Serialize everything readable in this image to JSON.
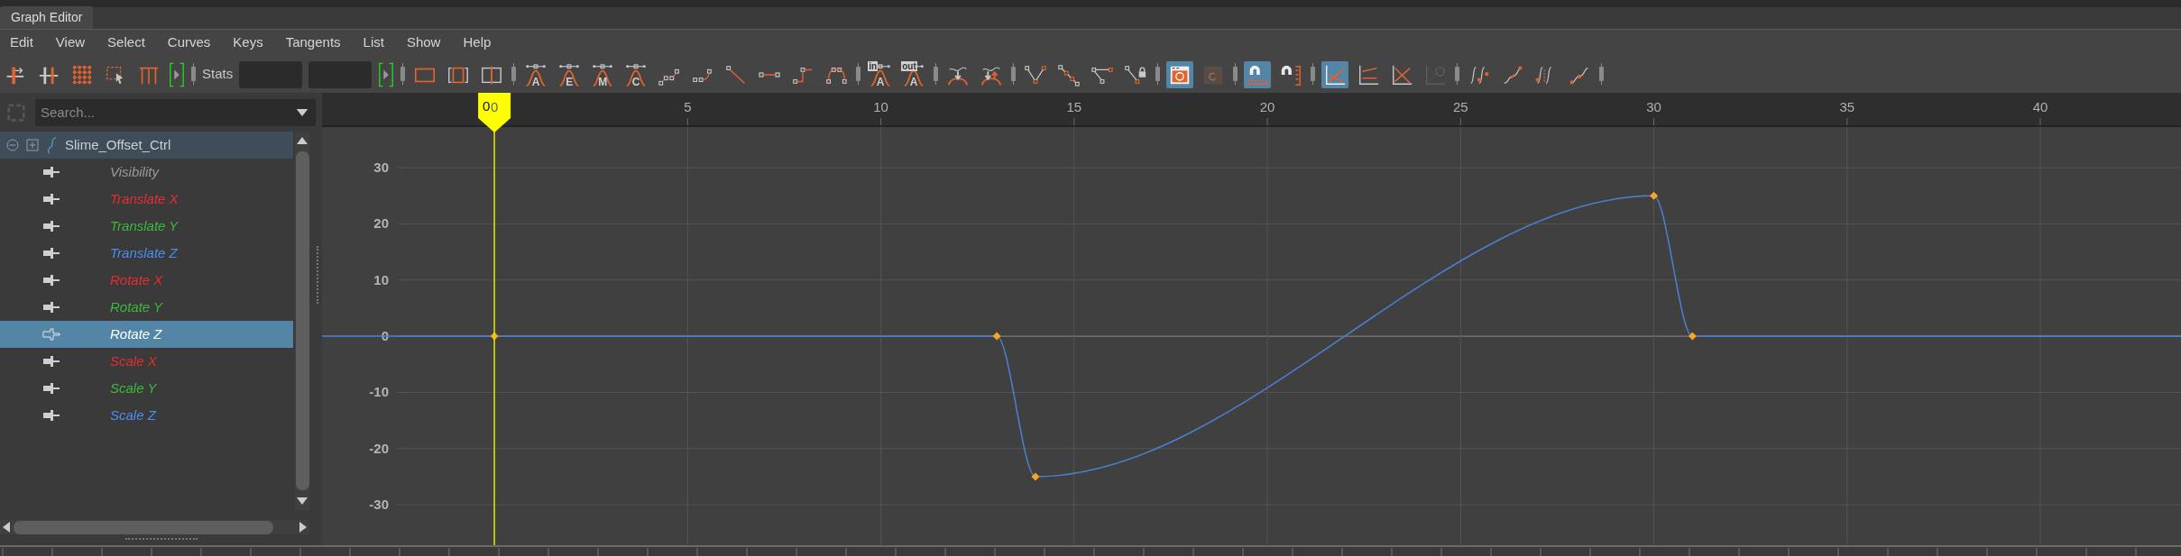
{
  "window": {
    "tab": "Graph Editor"
  },
  "menu": [
    "Edit",
    "View",
    "Select",
    "Curves",
    "Keys",
    "Tangents",
    "List",
    "Show",
    "Help"
  ],
  "toolbar": [
    {
      "kind": "tool",
      "on": false,
      "disabled": false
    },
    {
      "kind": "tool",
      "on": false,
      "disabled": false
    },
    {
      "kind": "tool",
      "on": false,
      "disabled": false
    },
    {
      "kind": "tool",
      "on": false,
      "disabled": false
    },
    {
      "kind": "tool",
      "on": false,
      "disabled": false
    },
    {
      "kind": "bracket"
    },
    {
      "kind": "separator"
    },
    {
      "kind": "label",
      "text": "Stats"
    },
    {
      "kind": "field"
    },
    {
      "kind": "field"
    },
    {
      "kind": "bracket"
    },
    {
      "kind": "separator"
    },
    {
      "kind": "tool",
      "on": false,
      "disabled": false
    },
    {
      "kind": "tool",
      "on": false,
      "disabled": false
    },
    {
      "kind": "tool",
      "on": false,
      "disabled": false
    },
    {
      "kind": "separator"
    },
    {
      "kind": "tool",
      "on": false,
      "disabled": false,
      "letter": "A"
    },
    {
      "kind": "tool",
      "on": false,
      "disabled": false,
      "letter": "E"
    },
    {
      "kind": "tool",
      "on": false,
      "disabled": false,
      "letter": "M"
    },
    {
      "kind": "tool",
      "on": false,
      "disabled": false,
      "letter": "C"
    },
    {
      "kind": "tool",
      "on": false,
      "disabled": false
    },
    {
      "kind": "tool",
      "on": false,
      "disabled": false
    },
    {
      "kind": "tool",
      "on": false,
      "disabled": false
    },
    {
      "kind": "tool",
      "on": false,
      "disabled": false
    },
    {
      "kind": "tool",
      "on": false,
      "disabled": false
    },
    {
      "kind": "tool",
      "on": false,
      "disabled": false
    },
    {
      "kind": "separator"
    },
    {
      "kind": "tool",
      "on": false,
      "disabled": false,
      "tag": "in",
      "letter": "A"
    },
    {
      "kind": "tool",
      "on": false,
      "disabled": false,
      "tag": "out",
      "letter": "A"
    },
    {
      "kind": "separator"
    },
    {
      "kind": "tool",
      "on": false,
      "disabled": false
    },
    {
      "kind": "tool",
      "on": false,
      "disabled": false
    },
    {
      "kind": "separator"
    },
    {
      "kind": "tool",
      "on": false,
      "disabled": false
    },
    {
      "kind": "tool",
      "on": false,
      "disabled": false
    },
    {
      "kind": "tool",
      "on": false,
      "disabled": false
    },
    {
      "kind": "tool",
      "on": false,
      "disabled": false
    },
    {
      "kind": "separator"
    },
    {
      "kind": "tool",
      "on": true,
      "disabled": false
    },
    {
      "kind": "tool",
      "on": false,
      "disabled": true
    },
    {
      "kind": "separator"
    },
    {
      "kind": "tool",
      "on": true,
      "disabled": false
    },
    {
      "kind": "tool",
      "on": false,
      "disabled": false
    },
    {
      "kind": "separator"
    },
    {
      "kind": "tool",
      "on": true,
      "disabled": false
    },
    {
      "kind": "tool",
      "on": false,
      "disabled": false
    },
    {
      "kind": "tool",
      "on": false,
      "disabled": false
    },
    {
      "kind": "tool",
      "on": false,
      "disabled": true
    },
    {
      "kind": "separator"
    },
    {
      "kind": "tool",
      "on": false,
      "disabled": false
    },
    {
      "kind": "tool",
      "on": false,
      "disabled": false
    },
    {
      "kind": "tool",
      "on": false,
      "disabled": false
    },
    {
      "kind": "tool",
      "on": false,
      "disabled": false
    },
    {
      "kind": "separator"
    }
  ],
  "outliner": {
    "search": {
      "placeholder": "Search..."
    },
    "tree": [
      {
        "label": "Slime_Offset_Ctrl",
        "expanded": true,
        "children": [
          {
            "label": "Visibility",
            "color": "#9a9a9a",
            "selected": false
          },
          {
            "label": "Translate X",
            "color": "#e62e2e",
            "selected": false
          },
          {
            "label": "Translate Y",
            "color": "#3cb93c",
            "selected": false
          },
          {
            "label": "Translate Z",
            "color": "#4b8ef0",
            "selected": false
          },
          {
            "label": "Rotate X",
            "color": "#e62e2e",
            "selected": false
          },
          {
            "label": "Rotate Y",
            "color": "#3cb93c",
            "selected": false
          },
          {
            "label": "Rotate Z",
            "selected": true
          },
          {
            "label": "Scale X",
            "color": "#e62e2e",
            "selected": false
          },
          {
            "label": "Scale Y",
            "color": "#3cb93c",
            "selected": false
          },
          {
            "label": "Scale Z",
            "color": "#4b8ef0",
            "selected": false
          }
        ]
      }
    ]
  },
  "graph": {
    "current_time": "0",
    "chart_data": {
      "type": "line",
      "x": [
        -4.46,
        0,
        13,
        14,
        30,
        31,
        43.64
      ],
      "series": [
        {
          "color": "#4a80d0",
          "marker": "diamond",
          "values": [
            0,
            0,
            0,
            -25,
            25,
            0,
            0
          ]
        }
      ],
      "ref_lines": [
        {
          "axis": "x",
          "value": 0,
          "color": "#e6e600"
        }
      ],
      "grid": true,
      "xlim": [
        -4.46,
        43.64
      ],
      "ylim": [
        -37.2,
        37.4
      ],
      "xticks": [
        0,
        5,
        10,
        15,
        20,
        25,
        30,
        35,
        40
      ],
      "yticks": [
        -30,
        -20,
        -10,
        0,
        10,
        20,
        30
      ]
    }
  }
}
